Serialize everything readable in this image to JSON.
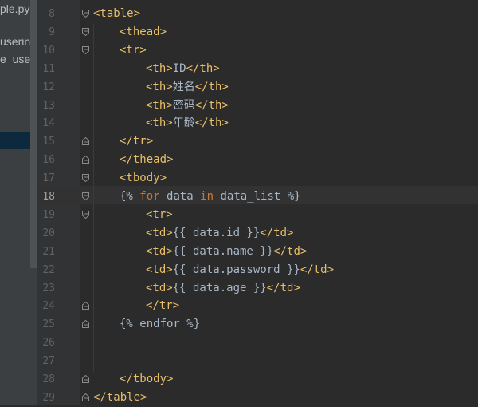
{
  "sidebar": {
    "items": [
      {
        "label": "ple.py"
      },
      {
        "label": "userinfo_"
      },
      {
        "label": "e_userin"
      }
    ]
  },
  "editor": {
    "current_line": "18",
    "lines": [
      {
        "num": "8",
        "fold": "open",
        "segs": [
          {
            "t": "<table>",
            "c": "tag"
          }
        ]
      },
      {
        "num": "9",
        "fold": "open",
        "segs": [
          {
            "t": "<thead>",
            "c": "tag"
          }
        ]
      },
      {
        "num": "10",
        "fold": "open",
        "segs": [
          {
            "t": "<tr>",
            "c": "tag"
          }
        ]
      },
      {
        "num": "11",
        "fold": "",
        "segs": [
          {
            "t": "<th>",
            "c": "tag"
          },
          {
            "t": "ID",
            "c": ""
          },
          {
            "t": "</th>",
            "c": "tag"
          }
        ]
      },
      {
        "num": "12",
        "fold": "",
        "segs": [
          {
            "t": "<th>",
            "c": "tag"
          },
          {
            "t": "姓名",
            "c": ""
          },
          {
            "t": "</th>",
            "c": "tag"
          }
        ]
      },
      {
        "num": "13",
        "fold": "",
        "segs": [
          {
            "t": "<th>",
            "c": "tag"
          },
          {
            "t": "密码",
            "c": ""
          },
          {
            "t": "</th>",
            "c": "tag"
          }
        ]
      },
      {
        "num": "14",
        "fold": "",
        "segs": [
          {
            "t": "<th>",
            "c": "tag"
          },
          {
            "t": "年龄",
            "c": ""
          },
          {
            "t": "</th>",
            "c": "tag"
          }
        ]
      },
      {
        "num": "15",
        "fold": "close",
        "segs": [
          {
            "t": "</tr>",
            "c": "tag"
          }
        ]
      },
      {
        "num": "16",
        "fold": "close",
        "segs": [
          {
            "t": "</thead>",
            "c": "tag"
          }
        ]
      },
      {
        "num": "17",
        "fold": "open",
        "segs": [
          {
            "t": "<tbody>",
            "c": "tag"
          }
        ]
      },
      {
        "num": "18",
        "fold": "open",
        "segs": [
          {
            "t": "{% ",
            "c": ""
          },
          {
            "t": "for",
            "c": "kw"
          },
          {
            "t": " data ",
            "c": ""
          },
          {
            "t": "in",
            "c": "kw"
          },
          {
            "t": " data_list %}",
            "c": ""
          }
        ]
      },
      {
        "num": "19",
        "fold": "open",
        "segs": [
          {
            "t": "<tr>",
            "c": "tag"
          }
        ]
      },
      {
        "num": "20",
        "fold": "",
        "segs": [
          {
            "t": "<td>",
            "c": "tag"
          },
          {
            "t": "{{ data.id }}",
            "c": ""
          },
          {
            "t": "</td>",
            "c": "tag"
          }
        ]
      },
      {
        "num": "21",
        "fold": "",
        "segs": [
          {
            "t": "<td>",
            "c": "tag"
          },
          {
            "t": "{{ data.name }}",
            "c": ""
          },
          {
            "t": "</td>",
            "c": "tag"
          }
        ]
      },
      {
        "num": "22",
        "fold": "",
        "segs": [
          {
            "t": "<td>",
            "c": "tag"
          },
          {
            "t": "{{ data.password }}",
            "c": ""
          },
          {
            "t": "</td>",
            "c": "tag"
          }
        ]
      },
      {
        "num": "23",
        "fold": "",
        "segs": [
          {
            "t": "<td>",
            "c": "tag"
          },
          {
            "t": "{{ data.age }}",
            "c": ""
          },
          {
            "t": "</td>",
            "c": "tag"
          }
        ]
      },
      {
        "num": "24",
        "fold": "close",
        "segs": [
          {
            "t": "</tr>",
            "c": "tag"
          }
        ]
      },
      {
        "num": "25",
        "fold": "close",
        "segs": [
          {
            "t": "{% endfor %}",
            "c": ""
          }
        ]
      },
      {
        "num": "26",
        "fold": "",
        "segs": []
      },
      {
        "num": "27",
        "fold": "",
        "segs": []
      },
      {
        "num": "28",
        "fold": "close",
        "segs": [
          {
            "t": "</tbody>",
            "c": "tag"
          }
        ]
      },
      {
        "num": "29",
        "fold": "close",
        "segs": [
          {
            "t": "</table>",
            "c": "tag"
          }
        ]
      }
    ]
  }
}
